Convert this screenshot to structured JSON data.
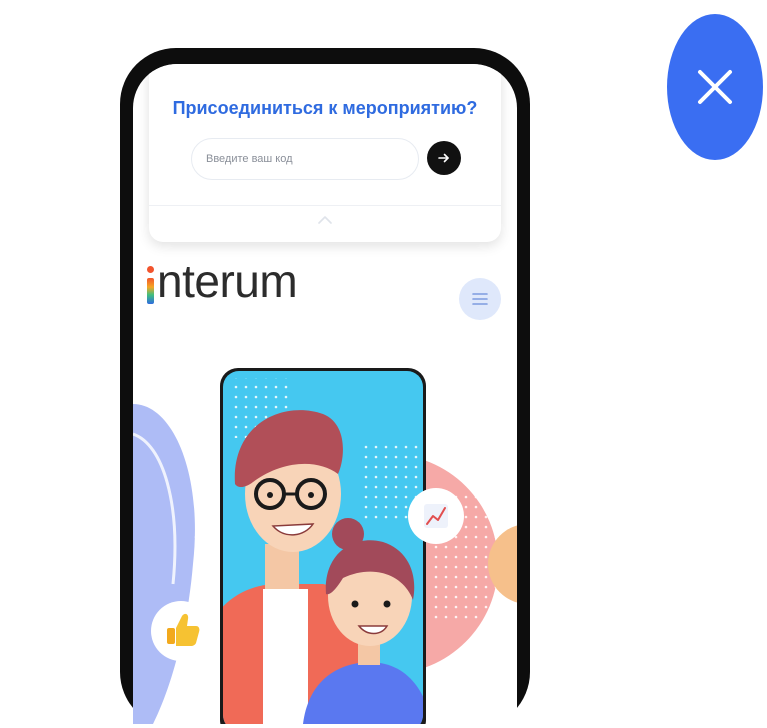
{
  "join": {
    "title": "Присоединиться к мероприятию?",
    "code_placeholder": "Введите ваш код",
    "code_value": ""
  },
  "brand": {
    "logo_text": "nterum",
    "logo_full": "interum"
  },
  "icons": {
    "close": "close-icon",
    "arrow": "arrow-right-icon",
    "chevron": "chevron-up-icon",
    "menu": "hamburger-icon",
    "chart": "chart-icon",
    "like": "thumbs-up-icon"
  },
  "colors": {
    "accent_blue": "#3a6ef2",
    "title_blue": "#2f6be0",
    "menu_bg": "#dfe8fb",
    "phone_frame": "#0d0d0d"
  }
}
